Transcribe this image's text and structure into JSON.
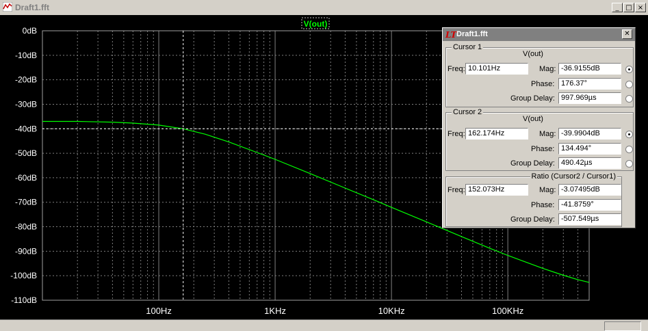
{
  "window": {
    "title": "Draft1.fft",
    "buttons": [
      "_",
      "□",
      "×"
    ]
  },
  "plot": {
    "trace_label": "V(out)",
    "trace_color": "#00ff00",
    "background": "#000000",
    "grid_color": "#808080",
    "y_ticks": [
      "0dB",
      "-10dB",
      "-20dB",
      "-30dB",
      "-40dB",
      "-50dB",
      "-60dB",
      "-70dB",
      "-80dB",
      "-90dB",
      "-100dB",
      "-110dB"
    ],
    "x_ticks": [
      "100Hz",
      "1KHz",
      "10KHz",
      "100KHz"
    ]
  },
  "chart_data": {
    "type": "line",
    "title": "V(out)",
    "xscale": "log",
    "x_ticks": [
      "100Hz",
      "1KHz",
      "10KHz",
      "100KHz"
    ],
    "xlim_hz": [
      10,
      500000
    ],
    "ylim_db": [
      -110,
      0
    ],
    "grid": true,
    "series": [
      {
        "name": "V(out)",
        "x_hz": [
          10,
          20,
          40,
          60,
          100,
          162,
          250,
          400,
          700,
          1000,
          2000,
          4000,
          7000,
          10000,
          20000,
          40000,
          70000,
          100000,
          200000,
          300000,
          400000,
          500000
        ],
        "y_db": [
          -37,
          -37,
          -37.3,
          -37.7,
          -38.5,
          -40,
          -42.2,
          -45.4,
          -49.7,
          -52.5,
          -58.3,
          -64.2,
          -69,
          -72.1,
          -78,
          -84,
          -88.8,
          -91.7,
          -97,
          -99.8,
          -101.6,
          -102.7
        ]
      }
    ],
    "cursors": [
      {
        "freq_hz": 162.174,
        "mag_db": -39.9904
      }
    ]
  },
  "cursor_dialog": {
    "title": "Draft1.fft",
    "cursor1": {
      "label": "Cursor 1",
      "trace": "V(out)",
      "freq_label": "Freq:",
      "freq": "10.101Hz",
      "mag_label": "Mag:",
      "mag": "-36.9155dB",
      "phase_label": "Phase:",
      "phase": "176.37°",
      "gd_label": "Group Delay:",
      "gd": "997.969µs"
    },
    "cursor2": {
      "label": "Cursor 2",
      "trace": "V(out)",
      "freq_label": "Freq:",
      "freq": "162.174Hz",
      "mag_label": "Mag:",
      "mag": "-39.9904dB",
      "phase_label": "Phase:",
      "phase": "134.494°",
      "gd_label": "Group Delay:",
      "gd": "490.42µs"
    },
    "ratio": {
      "label": "Ratio (Cursor2 / Cursor1)",
      "freq_label": "Freq:",
      "freq": "152.073Hz",
      "mag_label": "Mag:",
      "mag": "-3.07495dB",
      "phase_label": "Phase:",
      "phase": "-41.8759°",
      "gd_label": "Group Delay:",
      "gd": "-507.549µs"
    }
  }
}
